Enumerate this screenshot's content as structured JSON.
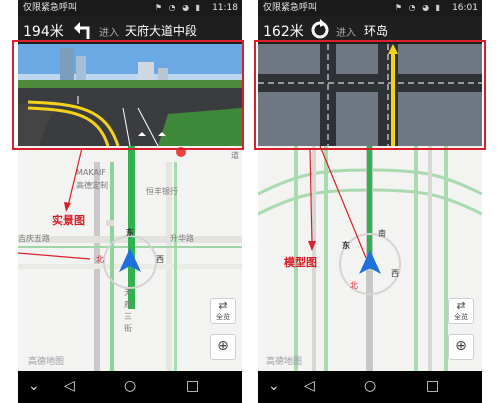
{
  "left": {
    "status": {
      "carrier": "仅限紧急呼叫",
      "time": "11:18"
    },
    "nav": {
      "distance": "194米",
      "enter": "进入",
      "road": "天府大道中段",
      "turn_icon": "turn-left-arrow"
    },
    "map": {
      "labels": [
        "MAKAIF",
        "高德定制",
        "恒丰银行",
        "吉庆五路",
        "升华路",
        "道"
      ],
      "road_vertical": [
        "天",
        "府",
        "三",
        "街"
      ],
      "compass_chars": [
        "东",
        "北",
        "西"
      ],
      "watermark": "高德地图",
      "fullview_label": "全览",
      "annotation": "实景图"
    }
  },
  "right": {
    "status": {
      "carrier": "仅限紧急呼叫",
      "time": "16:01"
    },
    "nav": {
      "distance": "162米",
      "enter": "进入",
      "road": "环岛",
      "turn_icon": "roundabout-arrow"
    },
    "map": {
      "compass_chars": [
        "东",
        "南",
        "西",
        "北"
      ],
      "watermark": "高德地图",
      "fullview_label": "全览",
      "annotation": "模型图"
    }
  },
  "colors": {
    "annotation_red": "#d9202a",
    "nav_bg": "#1f1f1f",
    "route_green": "#2eb34f",
    "gps_blue": "#1e6fe0"
  }
}
